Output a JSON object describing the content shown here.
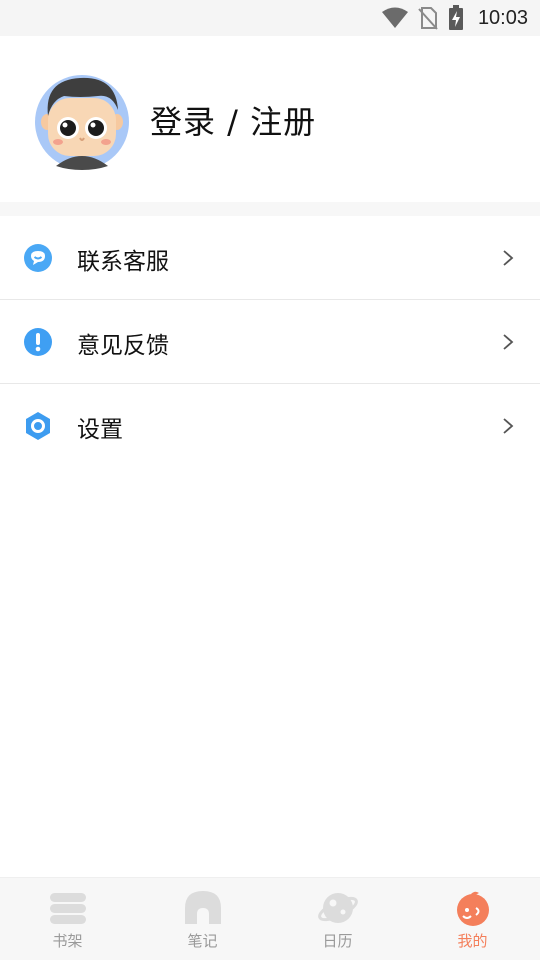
{
  "status_bar": {
    "time": "10:03",
    "icons": [
      "wifi-icon",
      "no-sim-icon",
      "battery-charging-icon"
    ]
  },
  "profile": {
    "avatar_icon": "cartoon-avatar-icon",
    "login_label": "登录 / 注册"
  },
  "menu": {
    "items": [
      {
        "label": "联系客服",
        "icon": "chat-bubble-icon",
        "icon_color": "#4aa8f5"
      },
      {
        "label": "意见反馈",
        "icon": "exclamation-icon",
        "icon_color": "#3f9ff3"
      },
      {
        "label": "设置",
        "icon": "gear-hexagon-icon",
        "icon_color": "#3d9cf0"
      }
    ]
  },
  "tab_bar": {
    "tabs": [
      {
        "label": "书架",
        "icon": "bookshelf-icon",
        "active": false
      },
      {
        "label": "笔记",
        "icon": "note-icon",
        "active": false
      },
      {
        "label": "日历",
        "icon": "planet-icon",
        "active": false
      },
      {
        "label": "我的",
        "icon": "profile-face-icon",
        "active": true
      }
    ],
    "inactive_color": "#dcdcdc",
    "active_color": "#f47f5b"
  }
}
